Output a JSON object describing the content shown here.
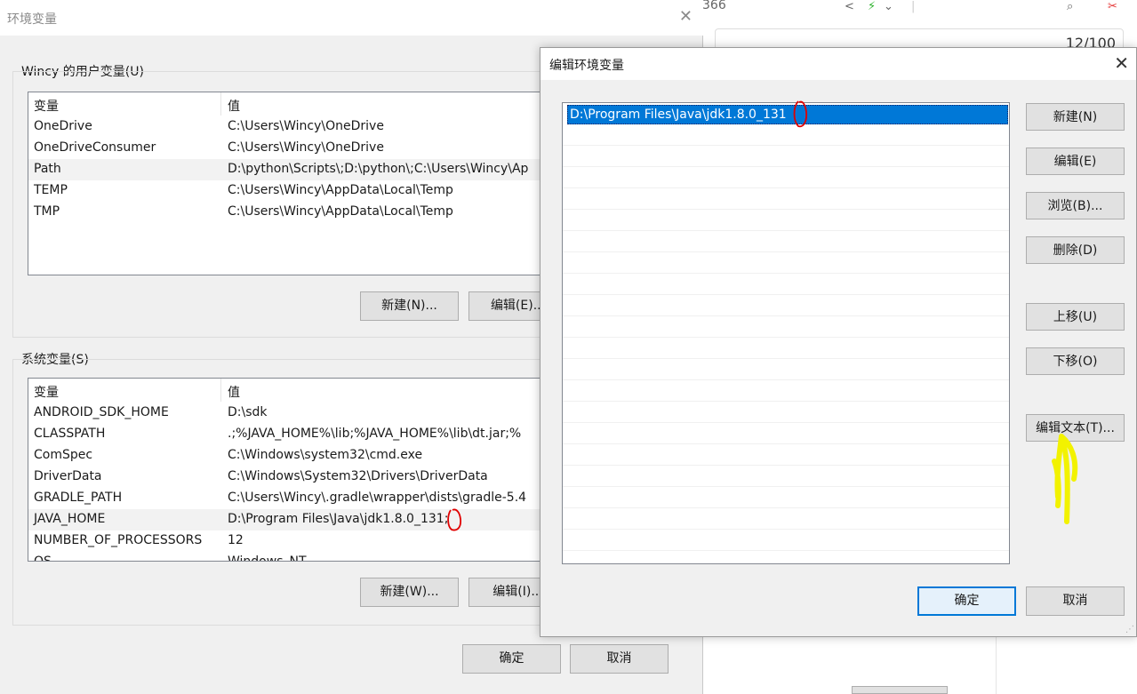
{
  "background_browser": {
    "title_fragment": "366",
    "counter": "12/100"
  },
  "env_dialog": {
    "title": "环境变量",
    "user_section": {
      "label": "Wincy 的用户变量(U)",
      "headers": [
        "变量",
        "值"
      ],
      "rows": [
        {
          "name": "OneDrive",
          "value": "C:\\Users\\Wincy\\OneDrive"
        },
        {
          "name": "OneDriveConsumer",
          "value": "C:\\Users\\Wincy\\OneDrive"
        },
        {
          "name": "Path",
          "value": "D:\\python\\Scripts\\;D:\\python\\;C:\\Users\\Wincy\\Ap"
        },
        {
          "name": "TEMP",
          "value": "C:\\Users\\Wincy\\AppData\\Local\\Temp"
        },
        {
          "name": "TMP",
          "value": "C:\\Users\\Wincy\\AppData\\Local\\Temp"
        }
      ],
      "selected_index": 2,
      "new_button": "新建(N)...",
      "edit_button": "编辑(E)..."
    },
    "system_section": {
      "label": "系统变量(S)",
      "headers": [
        "变量",
        "值"
      ],
      "rows": [
        {
          "name": "ANDROID_SDK_HOME",
          "value": "D:\\sdk"
        },
        {
          "name": "CLASSPATH",
          "value": ".;%JAVA_HOME%\\lib;%JAVA_HOME%\\lib\\dt.jar;%"
        },
        {
          "name": "ComSpec",
          "value": "C:\\Windows\\system32\\cmd.exe"
        },
        {
          "name": "DriverData",
          "value": "C:\\Windows\\System32\\Drivers\\DriverData"
        },
        {
          "name": "GRADLE_PATH",
          "value": "C:\\Users\\Wincy\\.gradle\\wrapper\\dists\\gradle-5.4"
        },
        {
          "name": "JAVA_HOME",
          "value": "D:\\Program Files\\Java\\jdk1.8.0_131;"
        },
        {
          "name": "NUMBER_OF_PROCESSORS",
          "value": "12"
        },
        {
          "name": "OS",
          "value": "Windows_NT"
        }
      ],
      "selected_index": 5,
      "new_button": "新建(W)...",
      "edit_button": "编辑(I)..."
    },
    "ok_button": "确定",
    "cancel_button": "取消"
  },
  "edit_dialog": {
    "title": "编辑环境变量",
    "entries": [
      "D:\\Program Files\\Java\\jdk1.8.0_131"
    ],
    "buttons": {
      "new": "新建(N)",
      "edit": "编辑(E)",
      "browse": "浏览(B)...",
      "delete": "删除(D)",
      "move_up": "上移(U)",
      "move_down": "下移(O)",
      "edit_text": "编辑文本(T)...",
      "ok": "确定",
      "cancel": "取消"
    }
  },
  "colors": {
    "selection": "#0078d7",
    "annotation_red": "#e00000",
    "annotation_yellow": "#f2f200"
  }
}
